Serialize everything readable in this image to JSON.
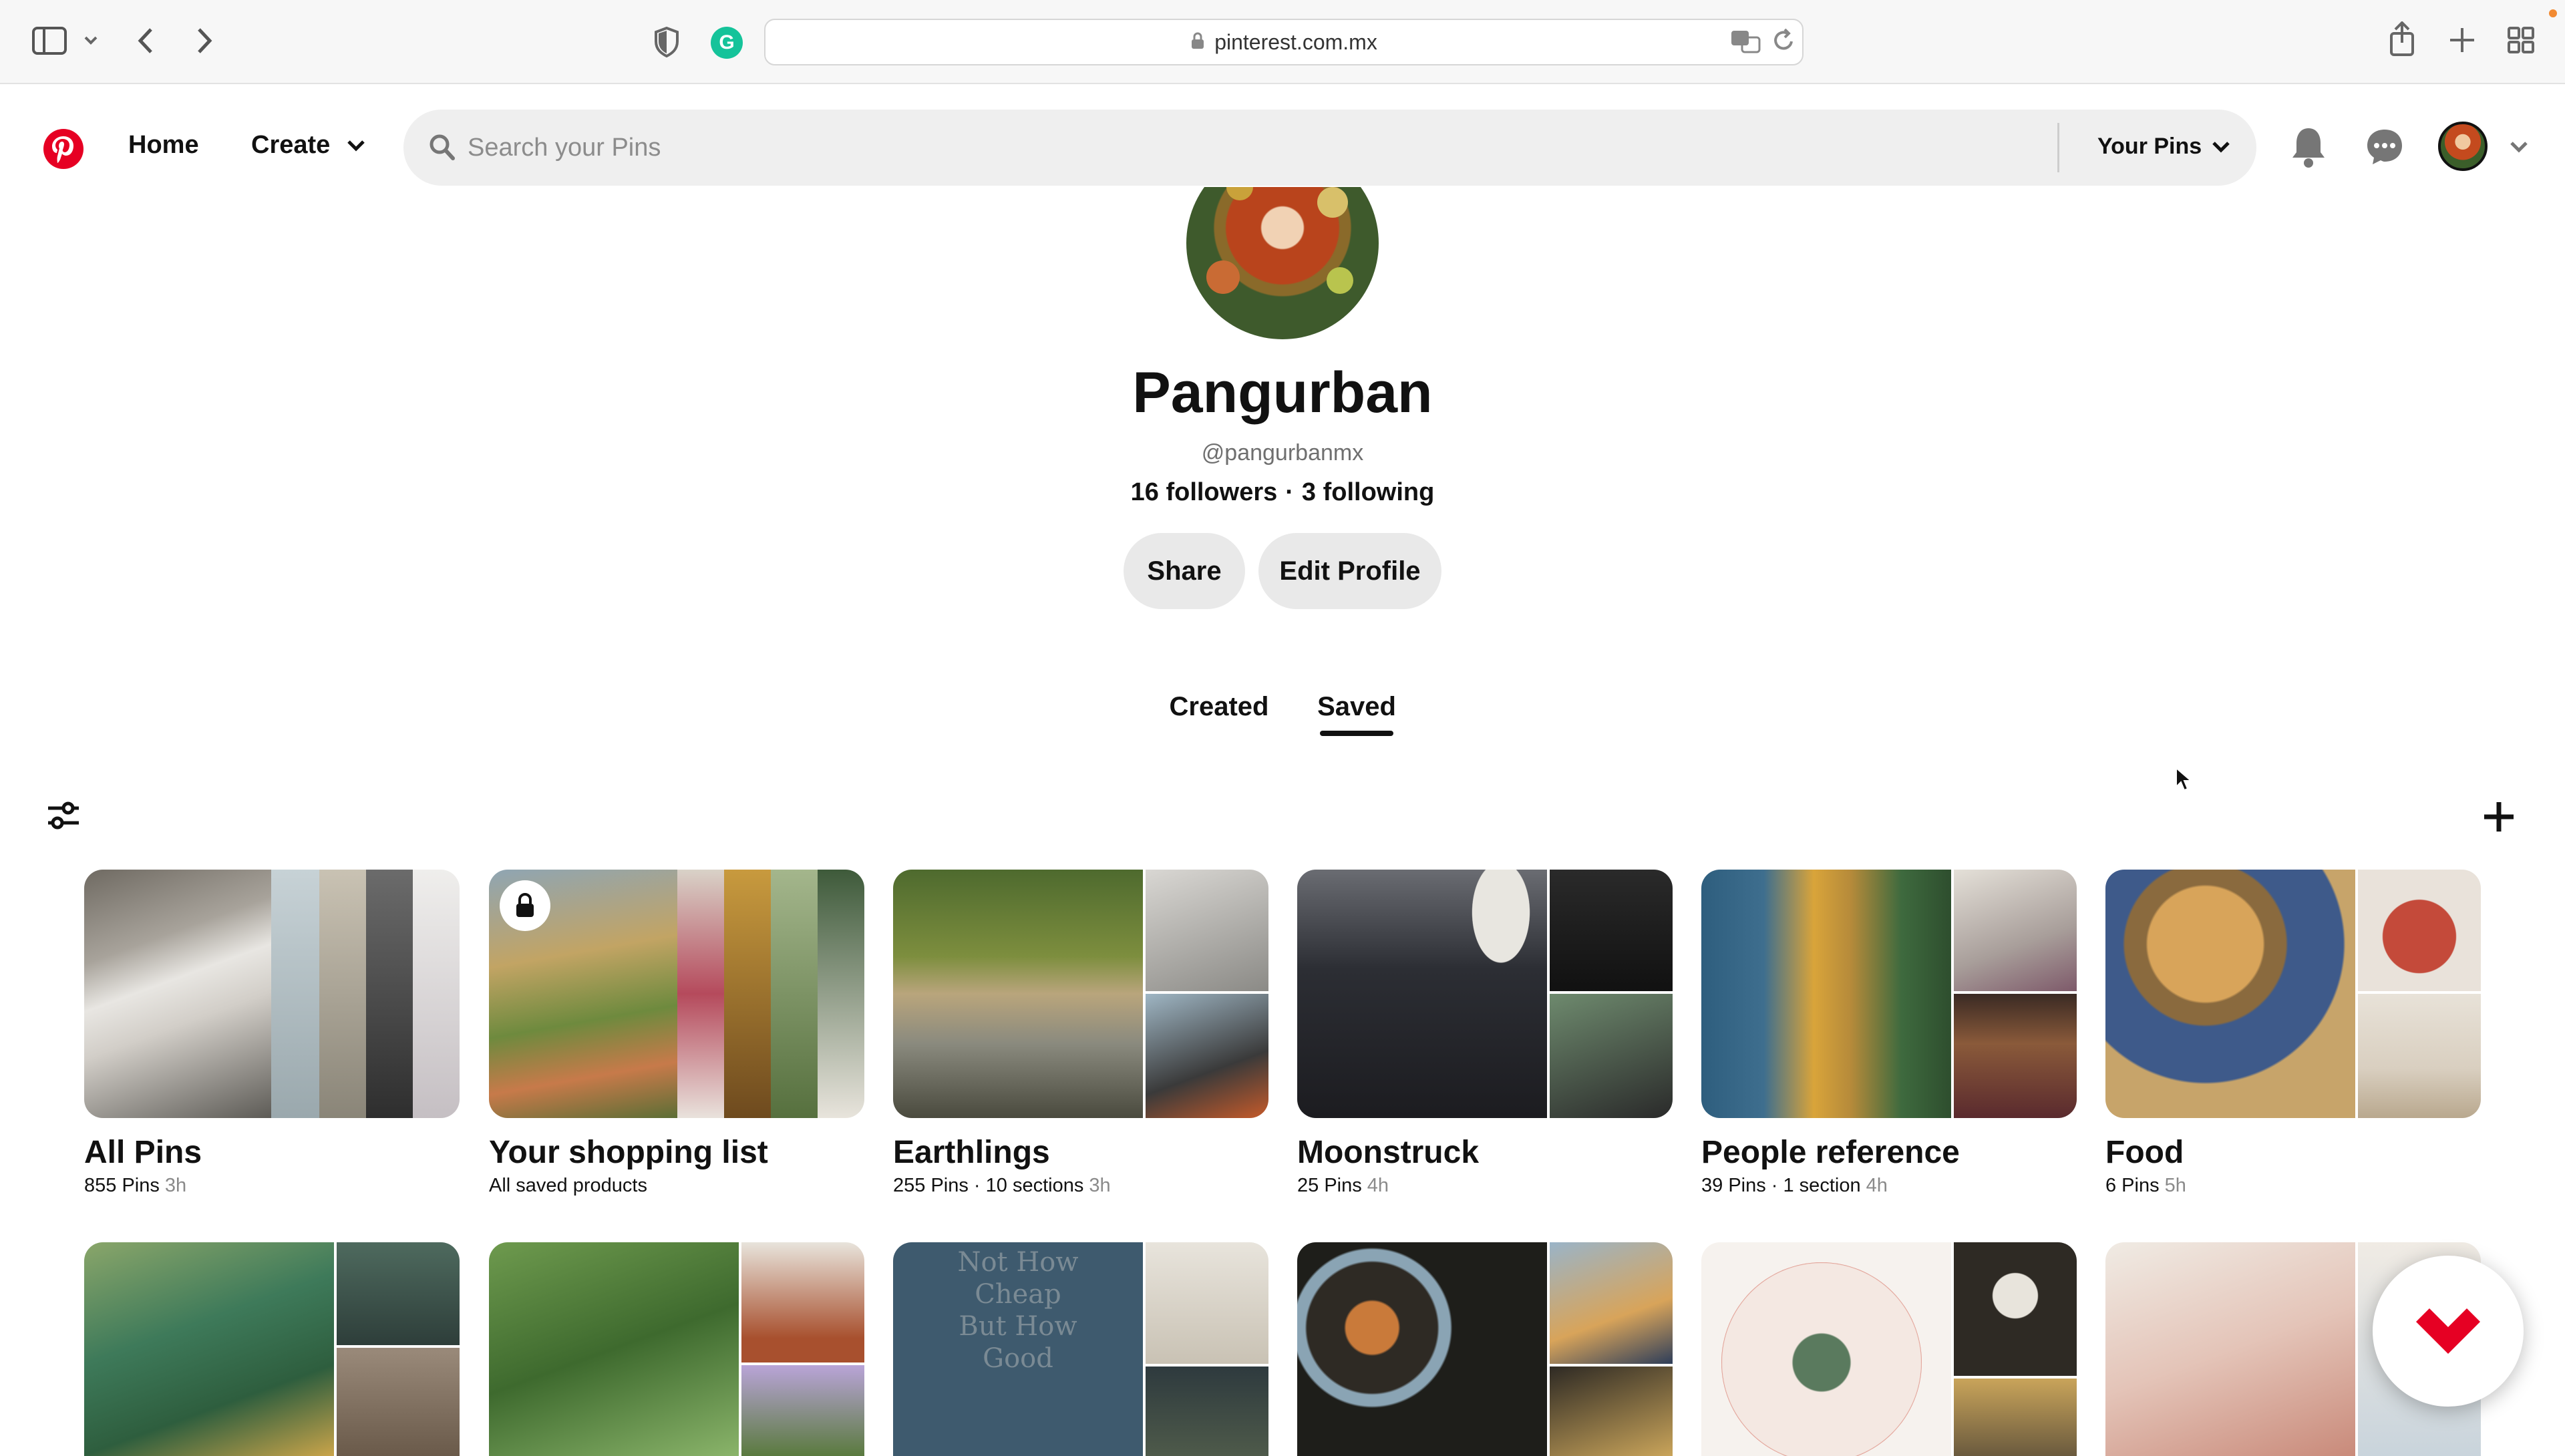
{
  "browser": {
    "url": "pinterest.com.mx"
  },
  "header": {
    "home_label": "Home",
    "create_label": "Create",
    "search_placeholder": "Search your Pins",
    "scope_label": "Your Pins"
  },
  "profile": {
    "name": "Pangurban",
    "handle": "@pangurbanmx",
    "followers": "16 followers",
    "separator": "·",
    "following": "3 following",
    "share_label": "Share",
    "edit_label": "Edit Profile"
  },
  "tabs": {
    "created": "Created",
    "saved": "Saved",
    "active": "Saved"
  },
  "boards": [
    {
      "title": "All Pins",
      "count": "855 Pins",
      "ago": "3h"
    },
    {
      "title": "Your shopping list",
      "count": "All saved products",
      "ago": ""
    },
    {
      "title": "Earthlings",
      "count": "255 Pins · 10 sections",
      "ago": "3h"
    },
    {
      "title": "Moonstruck",
      "count": "25 Pins",
      "ago": "4h"
    },
    {
      "title": "People reference",
      "count": "39 Pins · 1 section",
      "ago": "4h"
    },
    {
      "title": "Food",
      "count": "6 Pins",
      "ago": "5h"
    }
  ],
  "row2_cover_text": [
    "Not How",
    "Cheap",
    "But How",
    "Good"
  ],
  "colors": {
    "brand": "#e60023",
    "text": "#111111",
    "muted": "#6f6f6f",
    "button_bg": "#e9e9e9",
    "search_bg": "#efefef"
  }
}
